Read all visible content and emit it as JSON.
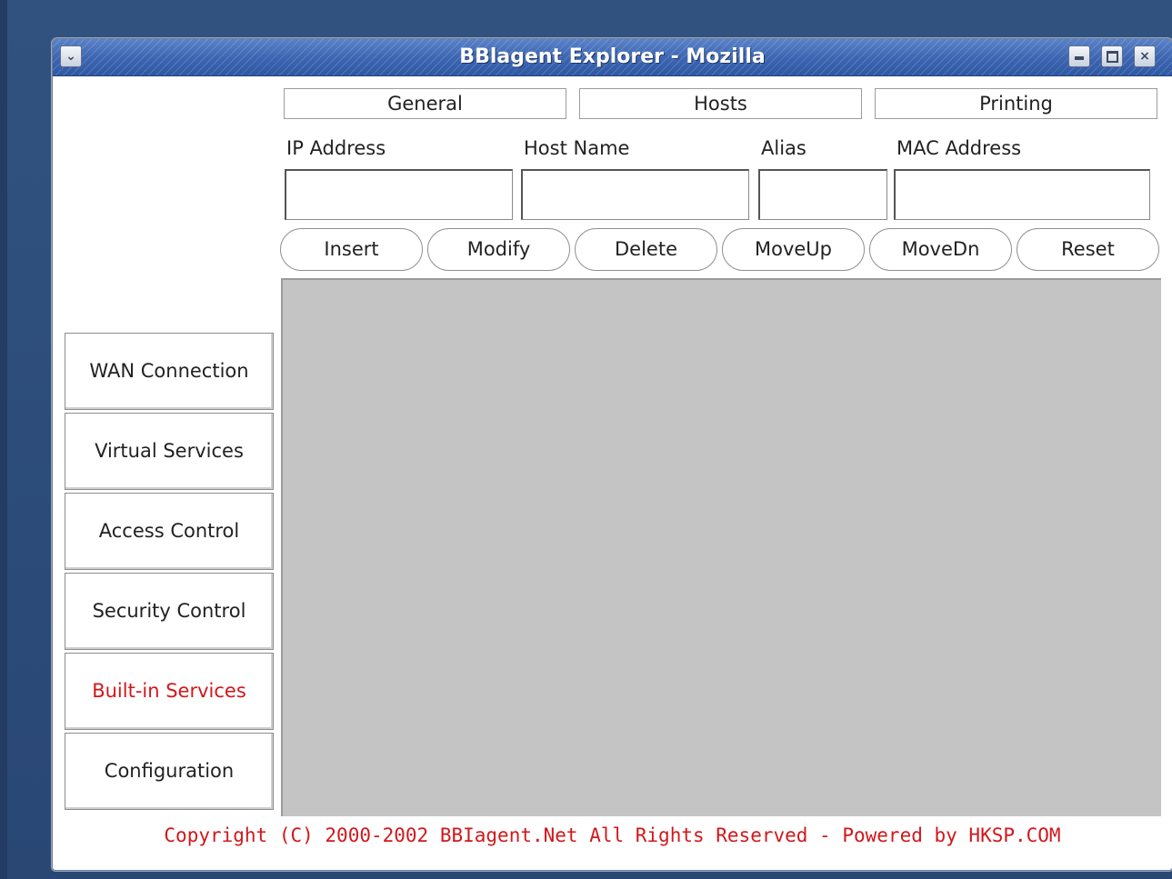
{
  "window": {
    "title": "BBlagent Explorer - Mozilla",
    "controls": {
      "menu": "⌄",
      "minimize": "minimize",
      "maximize": "maximize",
      "close": "×"
    }
  },
  "tabs": [
    {
      "label": "General"
    },
    {
      "label": "Hosts"
    },
    {
      "label": "Printing"
    }
  ],
  "form": {
    "ip_label": "IP Address",
    "host_label": "Host Name",
    "alias_label": "Alias",
    "mac_label": "MAC Address",
    "ip_value": "",
    "host_value": "",
    "alias_value": "",
    "mac_value": ""
  },
  "actions": {
    "insert": "Insert",
    "modify": "Modify",
    "delete": "Delete",
    "moveup": "MoveUp",
    "movedn": "MoveDn",
    "reset": "Reset"
  },
  "sidebar": {
    "items": [
      {
        "label": "WAN Connection"
      },
      {
        "label": "Virtual Services"
      },
      {
        "label": "Access Control"
      },
      {
        "label": "Security Control"
      },
      {
        "label": "Built-in Services"
      },
      {
        "label": "Configuration"
      }
    ],
    "active": "Built-in Services"
  },
  "footer": {
    "copyright": "Copyright (C) 2000-2002 BBIagent.Net All Rights Reserved - Powered by HKSP.COM"
  },
  "colors": {
    "accent_red": "#d2171b",
    "titlebar_blue": "#3e67b3",
    "list_area_grey": "#c4c4c4"
  }
}
